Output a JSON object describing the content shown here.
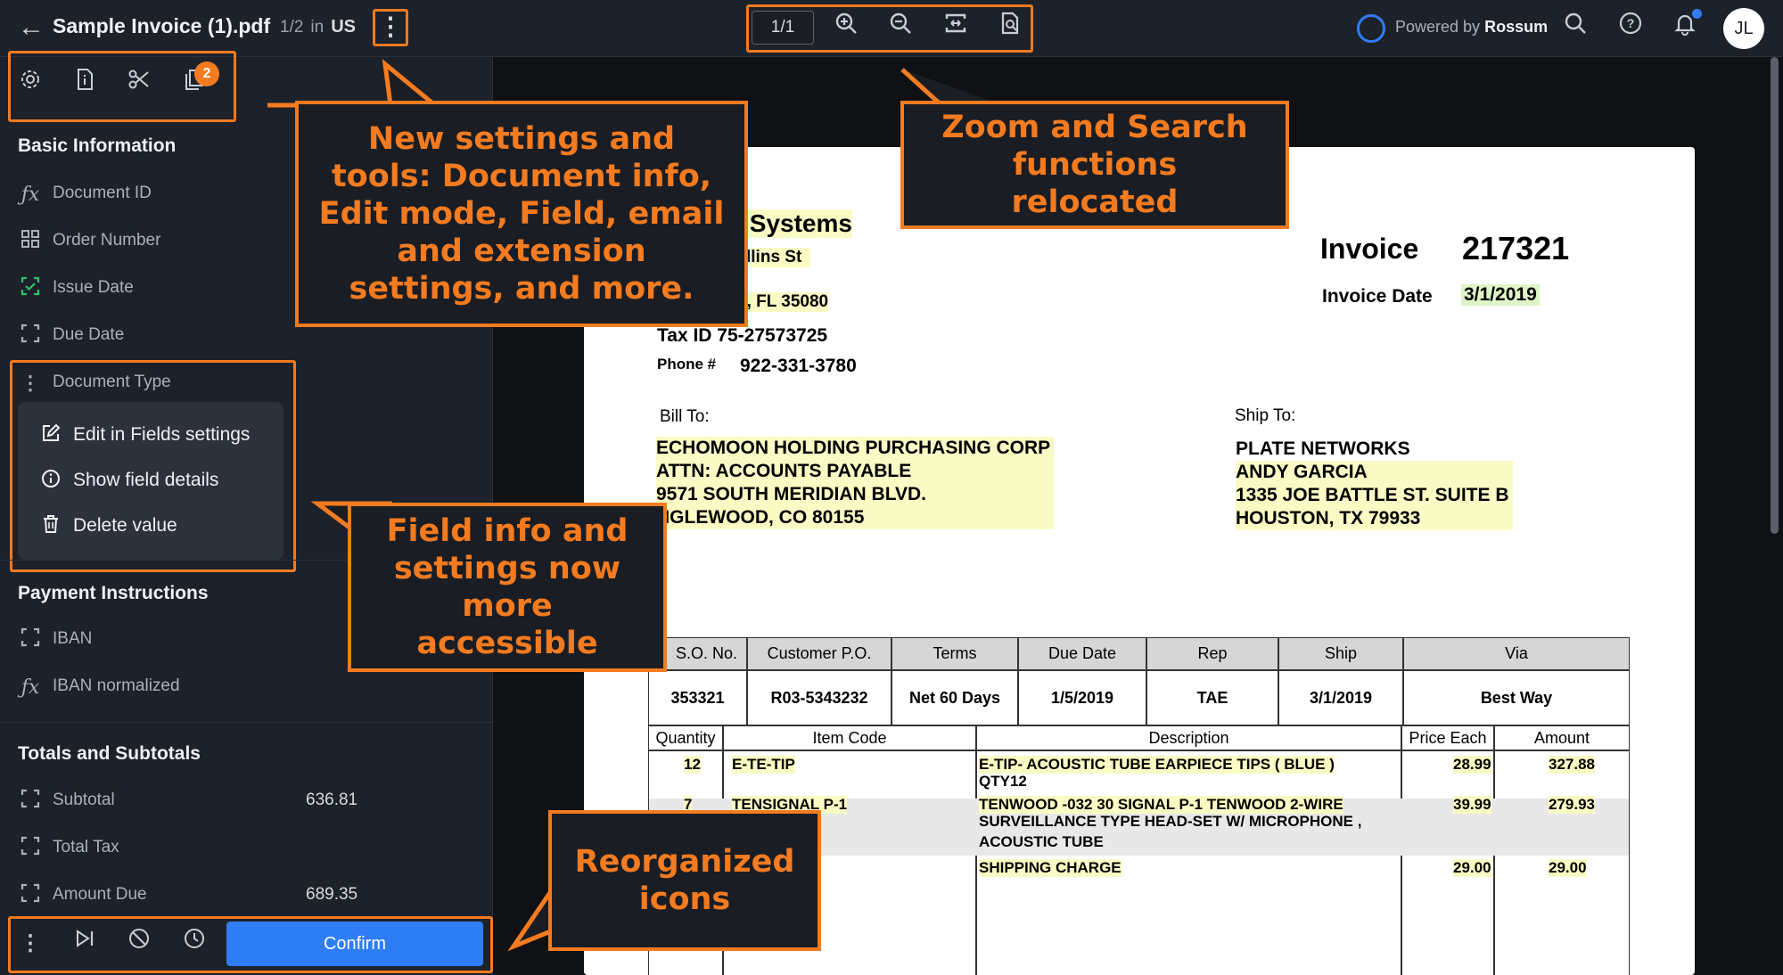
{
  "topbar": {
    "back_icon": "arrow-left-icon",
    "file_name": "Sample Invoice (1).pdf",
    "page_of": "1/2",
    "in_word": "in",
    "language": "US",
    "more_icon": "more-vertical-icon",
    "page_field": "1/1",
    "tool_icons": [
      "zoom-in-icon",
      "zoom-out-icon",
      "fit-width-icon",
      "search-document-icon"
    ],
    "powered_by": "Powered by",
    "brand": "Rossum",
    "right_icons": [
      "search-icon",
      "help-icon",
      "bell-icon"
    ],
    "avatar": "JL"
  },
  "sidebar": {
    "tool_icons": [
      "gear-icon",
      "document-info-icon",
      "scissors-icon",
      "copy-icon"
    ],
    "badge": "2",
    "sections": [
      {
        "title": "Basic Information",
        "fields": [
          {
            "label": "Document ID",
            "value": "",
            "icon": "formula-icon"
          },
          {
            "label": "Order Number",
            "value": "",
            "icon": "grid-icon"
          },
          {
            "label": "Issue Date",
            "value": "",
            "icon": "capture-check-icon"
          },
          {
            "label": "Due Date",
            "value": "",
            "icon": "capture-icon"
          },
          {
            "label": "Document Type",
            "value": "",
            "icon": "more-vertical-icon"
          }
        ]
      },
      {
        "title": "Payment Instructions",
        "fields": [
          {
            "label": "IBAN",
            "value": "",
            "icon": "capture-icon"
          },
          {
            "label": "IBAN normalized",
            "value": "",
            "icon": "formula-icon"
          }
        ]
      },
      {
        "title": "Totals and Subtotals",
        "fields": [
          {
            "label": "Subtotal",
            "value": "636.81",
            "icon": "capture-icon"
          },
          {
            "label": "Total Tax",
            "value": "",
            "icon": "capture-icon"
          },
          {
            "label": "Amount Due",
            "value": "689.35",
            "icon": "capture-icon"
          }
        ]
      }
    ],
    "menu": [
      {
        "label": "Edit in Fields settings",
        "icon": "edit-icon"
      },
      {
        "label": "Show field details",
        "icon": "info-icon"
      },
      {
        "label": "Delete value",
        "icon": "trash-icon"
      }
    ],
    "bottom_icons": [
      "more-vertical-icon",
      "skip-next-icon",
      "block-icon",
      "history-icon"
    ],
    "confirm_label": "Confirm"
  },
  "document": {
    "company": "ent Systems",
    "street": "llins St",
    "city": "e, FL 35080",
    "tax_id": "Tax ID 75-27573725",
    "phone_label": "Phone #",
    "phone": "922-331-3780",
    "invoice_label": "Invoice",
    "invoice_number": "217321",
    "invoice_date_label": "Invoice Date",
    "invoice_date": "3/1/2019",
    "bill_to_label": "Bill To:",
    "bill_to": [
      "ECHOMOON HOLDING PURCHASING CORP",
      "ATTN: ACCOUNTS PAYABLE",
      "9571 SOUTH MERIDIAN BLVD.",
      "NGLEWOOD, CO 80155"
    ],
    "ship_to_label": "Ship To:",
    "ship_to": [
      "PLATE NETWORKS",
      "ANDY GARCIA",
      "1335 JOE BATTLE ST. SUITE B",
      "HOUSTON, TX 79933"
    ],
    "header_table": {
      "columns": [
        "S.O. No.",
        "Customer P.O.",
        "Terms",
        "Due Date",
        "Rep",
        "Ship",
        "Via"
      ],
      "values": [
        "353321",
        "R03-5343232",
        "Net 60 Days",
        "1/5/2019",
        "TAE",
        "3/1/2019",
        "Best Way"
      ]
    },
    "items_table": {
      "columns": [
        "Quantity",
        "Item Code",
        "Description",
        "Price Each",
        "Amount"
      ],
      "rows": [
        {
          "qty": "12",
          "code": "E-TE-TIP",
          "desc1": "E-TIP- ACOUSTIC TUBE EARPIECE TIPS ( BLUE )",
          "desc2": "QTY12",
          "desc3": "",
          "price": "28.99",
          "amount": "327.88"
        },
        {
          "qty": "7",
          "code": "TENSIGNAL P-1",
          "desc1": "TENWOOD -032 30  SIGNAL P-1 TENWOOD 2-WIRE",
          "desc2": "SURVEILLANCE TYPE HEAD-SET W/ MICROPHONE ,",
          "desc3": "ACOUSTIC TUBE",
          "price": "39.99",
          "amount": "279.93"
        },
        {
          "qty": "",
          "code": "",
          "desc1": "SHIPPING CHARGE",
          "desc2": "",
          "desc3": "",
          "price": "29.00",
          "amount": "29.00"
        }
      ]
    }
  },
  "callouts": {
    "settings": "New settings and tools: Document info, Edit mode, Field, email and extension settings, and more.",
    "zoom": "Zoom and Search functions relocated",
    "field_info": "Field info and settings now more accessible",
    "icons": "Reorganized icons"
  },
  "colors": {
    "accent": "#f47b20",
    "primary": "#2f7df6",
    "panel": "#1d2129",
    "highlight": "#fafbc4"
  }
}
